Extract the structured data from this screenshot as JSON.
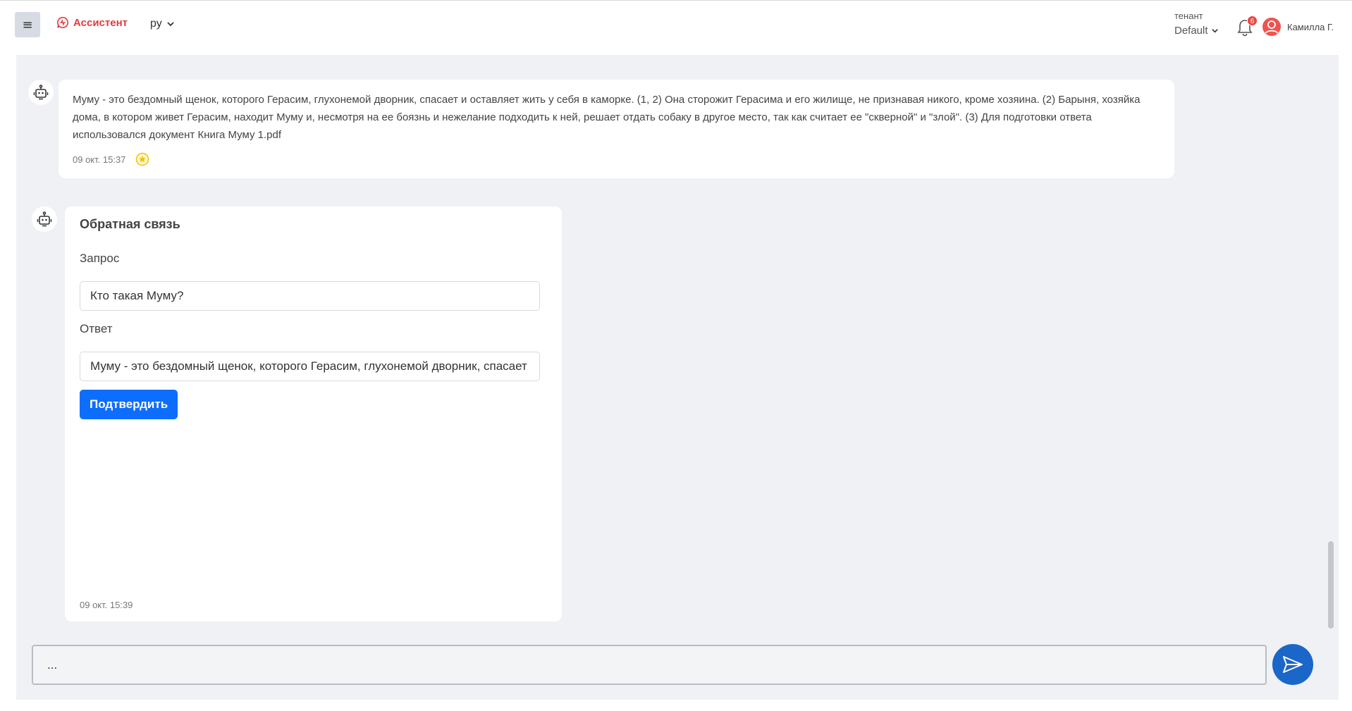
{
  "header": {
    "menu_glyph": "≡",
    "brand": "Ассистент",
    "language": "ру",
    "tenant_label": "тенант",
    "tenant_value": "Default",
    "notifications_count": "6",
    "user_name": "Камилла Г."
  },
  "messages": [
    {
      "text": "Муму - это бездомный щенок, которого Герасим, глухонемой дворник, спасает и оставляет жить у себя в каморке. (1, 2) Она сторожит Герасима и его жилище, не признавая никого, кроме хозяина. (2) Барыня, хозяйка дома, в котором живет Герасим, находит Муму и, несмотря на ее боязнь и нежелание подходить к ней, решает отдать собаку в другое место, так как считает ее \"скверной\" и \"злой\". (3) Для подготовки ответа использовался документ Книга Муму 1.pdf",
      "time": "09 окт. 15:37"
    }
  ],
  "feedback": {
    "title": "Обратная связь",
    "request_label": "Запрос",
    "request_value": "Кто такая Муму?",
    "answer_label": "Ответ",
    "answer_value": "Муму - это бездомный щенок, которого Герасим, глухонемой дворник, спасает и оставляет жить у себя в каморке.",
    "confirm_label": "Подтвердить",
    "time": "09 окт. 15:39"
  },
  "composer": {
    "value": "..."
  },
  "colors": {
    "brand": "#e5393d",
    "primary": "#0d6efd",
    "send": "#1b66c9",
    "chat_bg": "#eff1f5"
  }
}
